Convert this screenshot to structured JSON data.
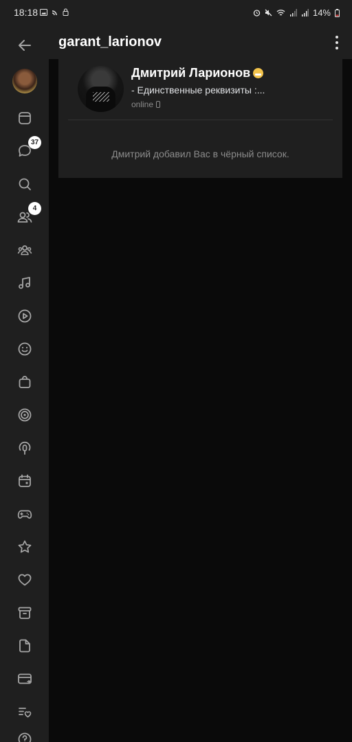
{
  "status_bar": {
    "time": "18:18",
    "battery": "14%",
    "left_icons": [
      "image-icon",
      "cast-icon",
      "lock-icon"
    ],
    "right_icons": [
      "alarm-icon",
      "mute-icon",
      "wifi-icon",
      "signal-icon",
      "signal-icon",
      "battery-icon"
    ]
  },
  "header": {
    "title": "garant_larionov",
    "menu_icon": "more-vertical-icon"
  },
  "sidebar": {
    "items": [
      {
        "icon": "back-arrow-icon"
      },
      {
        "icon": "profile-avatar"
      },
      {
        "icon": "news-icon"
      },
      {
        "icon": "messages-icon",
        "badge": "37"
      },
      {
        "icon": "search-icon"
      },
      {
        "icon": "friends-icon",
        "badge": "4"
      },
      {
        "icon": "communities-icon"
      },
      {
        "icon": "music-icon"
      },
      {
        "icon": "video-icon"
      },
      {
        "icon": "emoji-icon"
      },
      {
        "icon": "shopping-bag-icon"
      },
      {
        "icon": "target-icon"
      },
      {
        "icon": "podcast-icon"
      },
      {
        "icon": "calendar-icon"
      },
      {
        "icon": "gamepad-icon"
      },
      {
        "icon": "star-icon"
      },
      {
        "icon": "heart-icon"
      },
      {
        "icon": "archive-icon"
      },
      {
        "icon": "document-icon"
      },
      {
        "icon": "card-icon"
      },
      {
        "icon": "wishlist-icon"
      },
      {
        "icon": "help-icon"
      }
    ]
  },
  "profile": {
    "name": "Дмитрий Ларионов",
    "status": "- Единственные реквизиты :...",
    "online": "online",
    "blocked_message": "Дмитрий добавил Вас в чёрный список."
  },
  "colors": {
    "background": "#0a0a0a",
    "panel": "#1f1f1f",
    "text_primary": "#ffffff",
    "text_secondary": "#8c8c8c",
    "divider": "#333333"
  }
}
